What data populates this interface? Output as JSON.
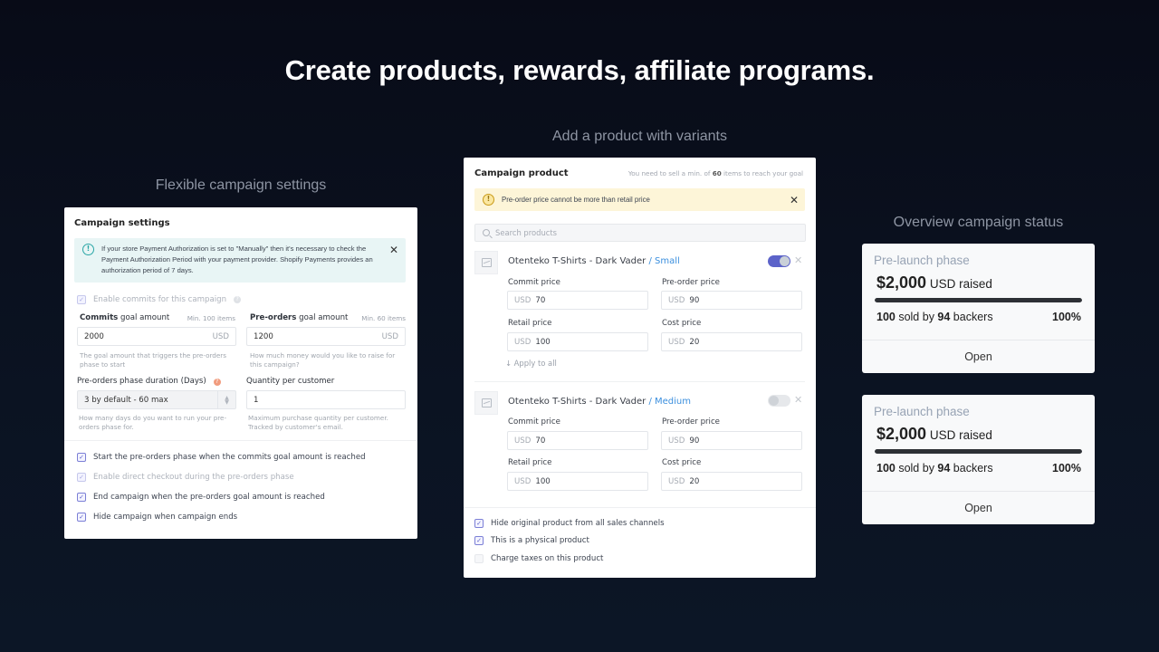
{
  "headline": "Create products, rewards, affiliate programs.",
  "sections": {
    "settings_label": "Flexible campaign settings",
    "product_label": "Add a product with variants",
    "status_label": "Overview campaign status"
  },
  "settings": {
    "title": "Campaign settings",
    "info_text": "If your store Payment Authorization is set to \"Manually\" then it's necessary to check the Payment Authorization Period with your payment provider. Shopify Payments provides an authorization period of 7 days.",
    "enable_commits": {
      "label": "Enable commits for this campaign",
      "checked": true
    },
    "commits_goal": {
      "label_bold": "Commits",
      "label_rest": " goal amount",
      "hint": "Min. 100 items",
      "value": "2000",
      "suffix": "USD",
      "help": "The goal amount that triggers the pre-orders phase to start"
    },
    "preorders_goal": {
      "label_bold": "Pre-orders",
      "label_rest": " goal amount",
      "hint": "Min. 60 items",
      "value": "1200",
      "suffix": "USD",
      "help": "How much money would you like to raise for this campaign?"
    },
    "duration": {
      "label": "Pre-orders phase duration (Days)",
      "value": "3 by default - 60 max",
      "help": "How many days do you want to run your pre-orders phase for."
    },
    "quantity": {
      "label": "Quantity per customer",
      "value": "1",
      "help": "Maximum purchase quantity per customer. Tracked by customer's email."
    },
    "options": [
      {
        "label": "Start the pre-orders phase when the commits goal amount is reached",
        "checked": true,
        "disabled": false
      },
      {
        "label": "Enable direct checkout during the pre-orders phase",
        "checked": true,
        "disabled": true
      },
      {
        "label": "End campaign when the pre-orders goal amount is reached",
        "checked": true,
        "disabled": false
      },
      {
        "label": "Hide campaign when campaign ends",
        "checked": true,
        "disabled": false
      }
    ]
  },
  "product": {
    "title": "Campaign product",
    "goal_note_pre": "You need to sell a min. of ",
    "goal_note_count": "60",
    "goal_note_post": " items to reach your goal",
    "warning": "Pre-order price cannot be more than retail price",
    "search_placeholder": "Search products",
    "apply_all": "↓ Apply to all",
    "variants": [
      {
        "name": "Otenteko T-Shirts - Dark Vader",
        "variant": " / Small",
        "enabled": true,
        "prices": [
          {
            "label": "Commit price",
            "currency": "USD",
            "value": "70"
          },
          {
            "label": "Pre-order price",
            "currency": "USD",
            "value": "90"
          },
          {
            "label": "Retail price",
            "currency": "USD",
            "value": "100"
          },
          {
            "label": "Cost price",
            "currency": "USD",
            "value": "20"
          }
        ]
      },
      {
        "name": "Otenteko T-Shirts - Dark Vader",
        "variant": " / Medium",
        "enabled": false,
        "prices": [
          {
            "label": "Commit price",
            "currency": "USD",
            "value": "70"
          },
          {
            "label": "Pre-order price",
            "currency": "USD",
            "value": "90"
          },
          {
            "label": "Retail price",
            "currency": "USD",
            "value": "100"
          },
          {
            "label": "Cost price",
            "currency": "USD",
            "value": "20"
          }
        ]
      }
    ],
    "options": [
      {
        "label": "Hide original product from all sales channels",
        "checked": true
      },
      {
        "label": "This is a physical product",
        "checked": true
      },
      {
        "label": "Charge taxes on this product",
        "checked": false
      }
    ]
  },
  "status_cards": [
    {
      "phase": "Pre-launch phase",
      "amount": "$2,000",
      "amount_suffix": " USD raised",
      "sold": "100",
      "sold_mid": " sold by ",
      "backers": "94",
      "backers_suffix": " backers",
      "percent": "100%",
      "progress": 1.0,
      "action": "Open"
    },
    {
      "phase": "Pre-launch phase",
      "amount": "$2,000",
      "amount_suffix": " USD raised",
      "sold": "100",
      "sold_mid": " sold by ",
      "backers": "94",
      "backers_suffix": " backers",
      "percent": "100%",
      "progress": 1.0,
      "action": "Open"
    }
  ]
}
